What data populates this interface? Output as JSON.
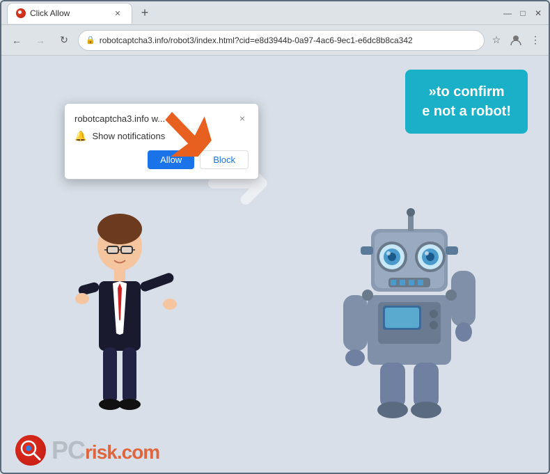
{
  "browser": {
    "tab": {
      "title": "Click Allow",
      "favicon": "warning-icon"
    },
    "url": "robotcaptcha3.info/robot3/index.html?cid=e8d3944b-0a97-4ac6-9ec1-e6dc8b8ca342",
    "new_tab_label": "+",
    "window_controls": {
      "minimize": "—",
      "maximize": "□",
      "close": "✕"
    }
  },
  "nav": {
    "back": "←",
    "forward": "→",
    "reload": "↻"
  },
  "teal_banner": {
    "line1": "»to confirm",
    "line2": "e not a robot!"
  },
  "popup": {
    "site_name": "robotcaptcha3.info w...",
    "close_label": "×",
    "notification_text": "Show notifications",
    "allow_label": "Allow",
    "block_label": "Block"
  },
  "pcrisk": {
    "text": "PC",
    "dotcom": "risk.com"
  }
}
